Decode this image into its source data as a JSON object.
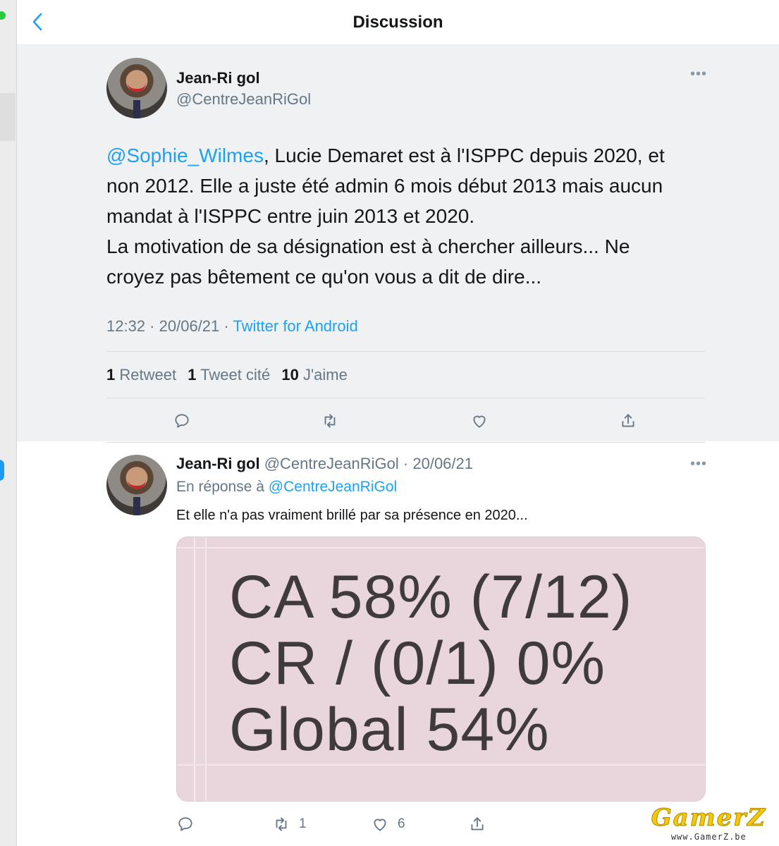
{
  "header": {
    "title": "Discussion",
    "back_icon": "chevron-left-icon"
  },
  "main_tweet": {
    "author_name": "Jean-Ri gol",
    "author_handle": "@CentreJeanRiGol",
    "mention": "@Sophie_Wilmes",
    "text_line1_rest": ", Lucie Demaret est à l'ISPPC depuis 2020, et",
    "text_line2": "non 2012. Elle a juste été admin 6 mois début 2013 mais aucun",
    "text_line3": "mandat à l'ISPPC entre juin 2013 et 2020.",
    "text_line4": "La motivation de sa désignation est à chercher ailleurs... Ne",
    "text_line5": "croyez pas bêtement ce qu'on vous a dit de dire...",
    "time": "12:32",
    "date": "20/06/21",
    "source": "Twitter for Android",
    "retweets_count": "1",
    "retweets_label": "Retweet",
    "quotes_count": "1",
    "quotes_label": "Tweet cité",
    "likes_count": "10",
    "likes_label": "J'aime"
  },
  "reply_tweet": {
    "author_name": "Jean-Ri gol",
    "author_handle": "@CentreJeanRiGol",
    "date": "20/06/21",
    "reply_prefix": "En réponse à",
    "reply_to": "@CentreJeanRiGol",
    "text": "Et elle n'a pas vraiment brillé par sa présence en 2020...",
    "image_lines": [
      "CA 58% (7/12)",
      "CR / (0/1) 0%",
      "Global 54%"
    ],
    "retweets": "1",
    "likes": "6"
  },
  "watermark": {
    "logo": "GamerZ",
    "url": "www.GamerZ.be"
  },
  "colors": {
    "accent": "#1da1f2",
    "muted": "#657786",
    "tweet_bg": "#f0f1f3",
    "media_bg": "#e8d6dc"
  }
}
